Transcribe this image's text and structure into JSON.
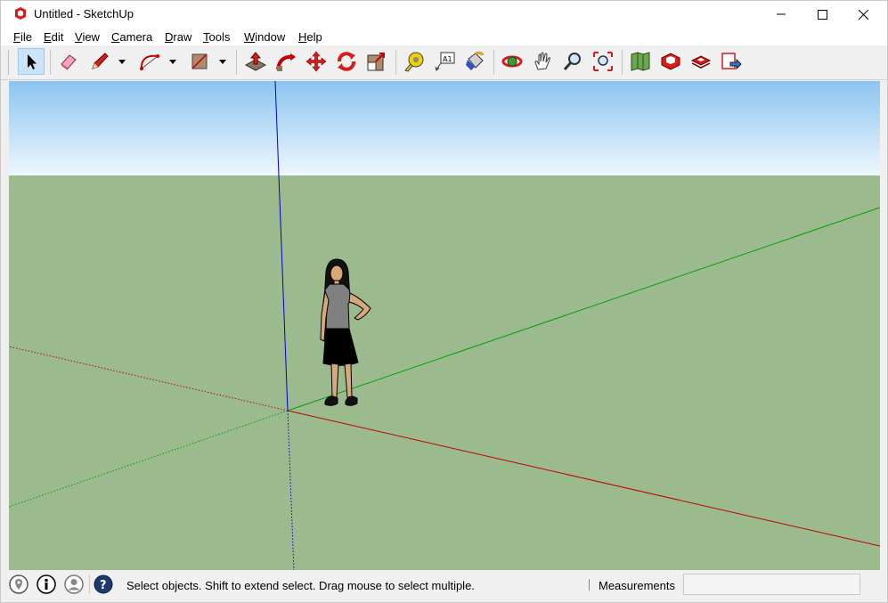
{
  "window": {
    "title": "Untitled - SketchUp",
    "controls": {
      "minimize": "minimize",
      "maximize": "maximize",
      "close": "close"
    }
  },
  "menu": [
    {
      "label": "File",
      "mnemonic": "F",
      "rest": "ile"
    },
    {
      "label": "Edit",
      "mnemonic": "E",
      "rest": "dit"
    },
    {
      "label": "View",
      "mnemonic": "V",
      "rest": "iew"
    },
    {
      "label": "Camera",
      "mnemonic": "C",
      "rest": "amera"
    },
    {
      "label": "Draw",
      "mnemonic": "D",
      "rest": "raw"
    },
    {
      "label": "Tools",
      "mnemonic": "T",
      "rest": "ools"
    },
    {
      "label": "Window",
      "mnemonic": "W",
      "rest": "indow"
    },
    {
      "label": "Help",
      "mnemonic": "H",
      "rest": "elp"
    }
  ],
  "toolbar": {
    "tools": [
      "select",
      "eraser",
      "line",
      "arc",
      "rectangle",
      "push-pull",
      "follow-me",
      "move",
      "rotate",
      "scale",
      "tape-measure",
      "text",
      "paint-bucket",
      "orbit",
      "pan",
      "zoom",
      "zoom-extents",
      "3d-warehouse",
      "extension-warehouse",
      "layout",
      "send-to-layout"
    ],
    "active_tool": "select"
  },
  "scene": {
    "sky_color": "#8cc4f0",
    "ground_color": "#9bbb8f",
    "axis_colors": {
      "red": "#c00000",
      "green": "#00a000",
      "blue": "#0000c8"
    },
    "figure": "standing woman"
  },
  "status": {
    "icons": [
      "geo-location",
      "credits",
      "user-account",
      "help"
    ],
    "message": "Select objects. Shift to extend select. Drag mouse to select multiple.",
    "measurements_label": "Measurements",
    "measurements_value": ""
  }
}
